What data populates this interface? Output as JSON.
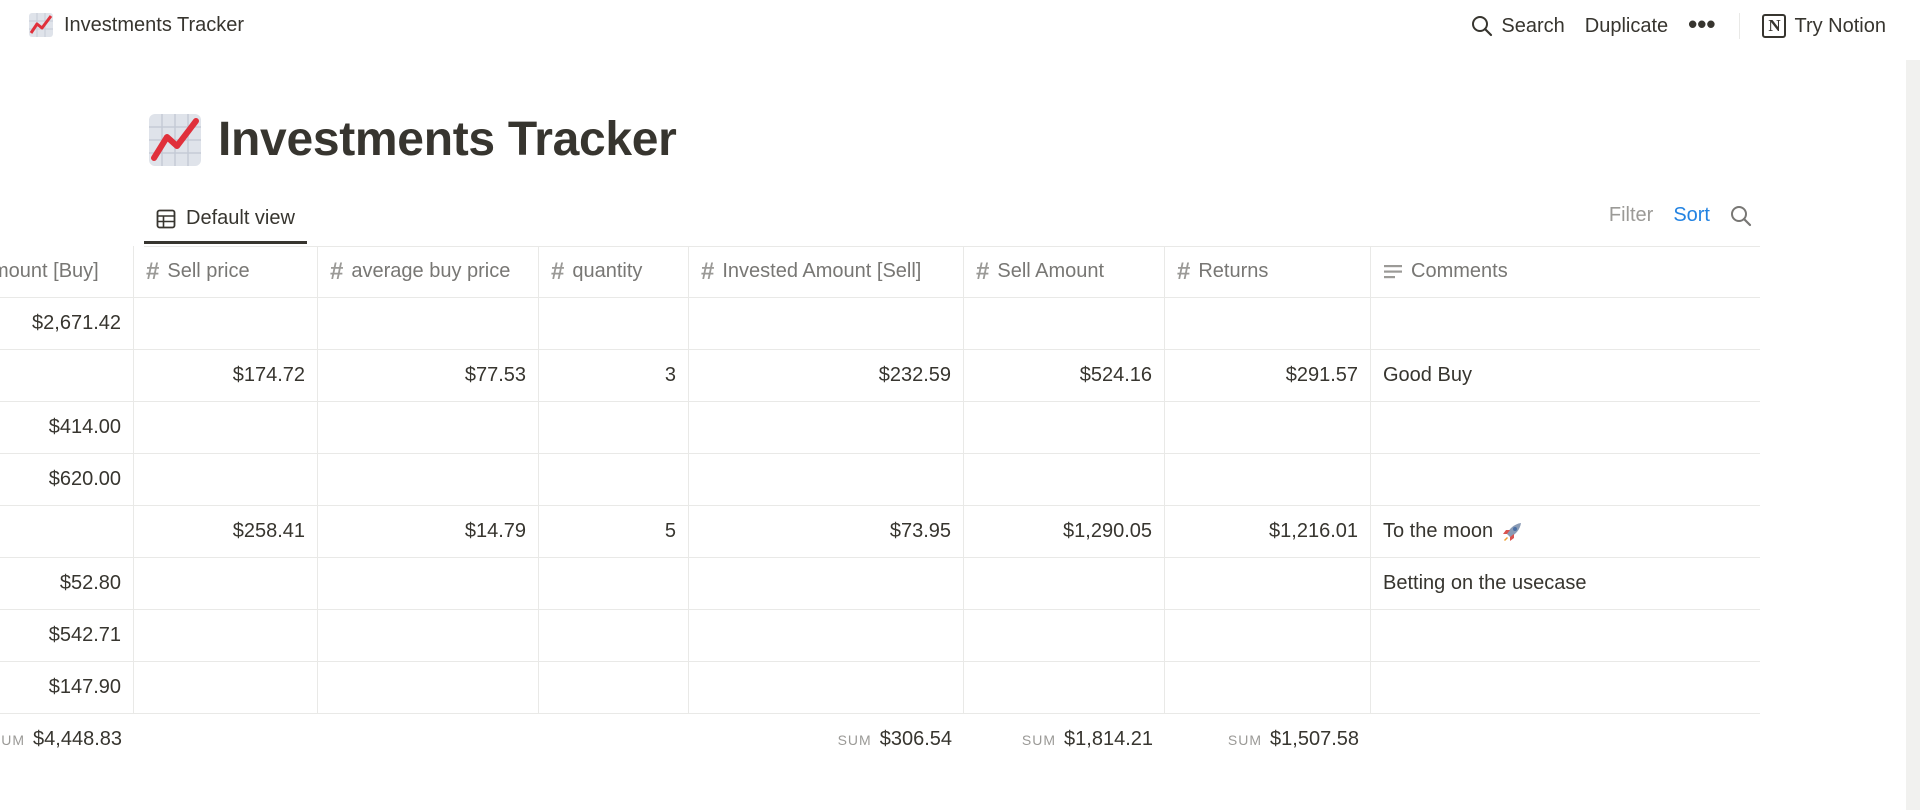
{
  "topbar": {
    "page_name": "Investments Tracker",
    "search_label": "Search",
    "duplicate_label": "Duplicate",
    "more_label": "•••",
    "try_notion_label": "Try Notion",
    "notion_logo_letter": "N"
  },
  "page": {
    "title": "Investments Tracker",
    "icon": "chart-increasing-icon"
  },
  "view": {
    "tab_label": "Default view",
    "filter_label": "Filter",
    "sort_label": "Sort"
  },
  "table": {
    "columns": [
      {
        "label": "mount [Buy]",
        "icon": "hash-icon"
      },
      {
        "label": "Sell price",
        "icon": "hash-icon"
      },
      {
        "label": "average buy price",
        "icon": "hash-icon"
      },
      {
        "label": "quantity",
        "icon": "hash-icon"
      },
      {
        "label": "Invested Amount [Sell]",
        "icon": "hash-icon"
      },
      {
        "label": "Sell Amount",
        "icon": "hash-icon"
      },
      {
        "label": "Returns",
        "icon": "hash-icon"
      },
      {
        "label": "Comments",
        "icon": "text-lines-icon"
      }
    ],
    "rows": [
      [
        "$2,671.42",
        "",
        "",
        "",
        "",
        "",
        "",
        ""
      ],
      [
        "",
        "$174.72",
        "$77.53",
        "3",
        "$232.59",
        "$524.16",
        "$291.57",
        "Good Buy"
      ],
      [
        "$414.00",
        "",
        "",
        "",
        "",
        "",
        "",
        ""
      ],
      [
        "$620.00",
        "",
        "",
        "",
        "",
        "",
        "",
        ""
      ],
      [
        "",
        "$258.41",
        "$14.79",
        "5",
        "$73.95",
        "$1,290.05",
        "$1,216.01",
        "To the moon"
      ],
      [
        "$52.80",
        "",
        "",
        "",
        "",
        "",
        "",
        "Betting on the usecase"
      ],
      [
        "$542.71",
        "",
        "",
        "",
        "",
        "",
        "",
        ""
      ],
      [
        "$147.90",
        "",
        "",
        "",
        "",
        "",
        "",
        ""
      ]
    ],
    "sums": {
      "buy_label": "UM",
      "buy_value": "$4,448.83",
      "sell_invested_label": "SUM",
      "sell_invested_value": "$306.54",
      "sell_amount_label": "SUM",
      "sell_amount_value": "$1,814.21",
      "returns_label": "SUM",
      "returns_value": "$1,507.58"
    }
  }
}
